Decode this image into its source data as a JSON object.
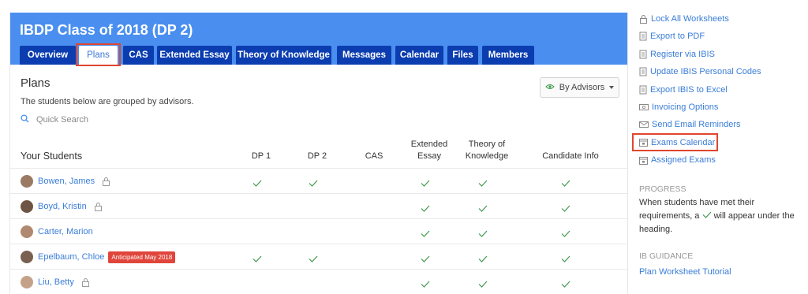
{
  "header": {
    "title": "IBDP Class of 2018 (DP 2)"
  },
  "tabs": [
    "Overview",
    "Plans",
    "CAS",
    "Extended Essay",
    "Theory of Knowledge",
    "Messages",
    "Calendar",
    "Files",
    "Members"
  ],
  "plans": {
    "title": "Plans",
    "description": "The students below are grouped by advisors.",
    "search_placeholder": "Quick Search",
    "group_button": "By Advisors"
  },
  "table": {
    "students_header": "Your Students",
    "columns": [
      {
        "line1": "DP 1",
        "line2": ""
      },
      {
        "line1": "DP 2",
        "line2": ""
      },
      {
        "line1": "CAS",
        "line2": ""
      },
      {
        "line1": "Extended",
        "line2": "Essay"
      },
      {
        "line1": "Theory of",
        "line2": "Knowledge"
      },
      {
        "line1": "Candidate Info",
        "line2": ""
      }
    ],
    "rows": [
      {
        "name": "Bowen, James",
        "locked": true,
        "badge": "",
        "checks": [
          true,
          true,
          false,
          true,
          true,
          true
        ]
      },
      {
        "name": "Boyd, Kristin",
        "locked": true,
        "badge": "",
        "checks": [
          false,
          false,
          false,
          true,
          true,
          true
        ]
      },
      {
        "name": "Carter, Marion",
        "locked": false,
        "badge": "",
        "checks": [
          false,
          false,
          false,
          true,
          true,
          true
        ]
      },
      {
        "name": "Epelbaum, Chloe",
        "locked": false,
        "badge": "Anticipated May 2018",
        "checks": [
          true,
          true,
          false,
          true,
          true,
          true
        ]
      },
      {
        "name": "Liu, Betty",
        "locked": true,
        "badge": "",
        "checks": [
          false,
          false,
          false,
          true,
          true,
          true
        ]
      }
    ]
  },
  "sidebar": {
    "actions": [
      {
        "label": "Lock All Worksheets",
        "icon": "lock-icon"
      },
      {
        "label": "Export to PDF",
        "icon": "document-icon"
      },
      {
        "label": "Register via IBIS",
        "icon": "document-icon"
      },
      {
        "label": "Update IBIS Personal Codes",
        "icon": "document-icon"
      },
      {
        "label": "Export IBIS to Excel",
        "icon": "document-icon"
      },
      {
        "label": "Invoicing Options",
        "icon": "invoice-icon"
      },
      {
        "label": "Send Email Reminders",
        "icon": "envelope-icon"
      },
      {
        "label": "Exams Calendar",
        "icon": "calendar-icon"
      },
      {
        "label": "Assigned Exams",
        "icon": "calendar-icon"
      }
    ],
    "progress_heading": "PROGRESS",
    "progress_text_1": "When students have met their requirements, a",
    "progress_text_2": "will appear under the heading.",
    "guidance_heading": "IB GUIDANCE",
    "guidance_link": "Plan Worksheet Tutorial"
  },
  "colors": {
    "header_blue": "#4a8fef",
    "tab_navy": "#0b3db0",
    "link_blue": "#3a7dd8",
    "check_green": "#3f9a4d",
    "badge_red": "#e0453b",
    "highlight_red": "#e0452f"
  }
}
